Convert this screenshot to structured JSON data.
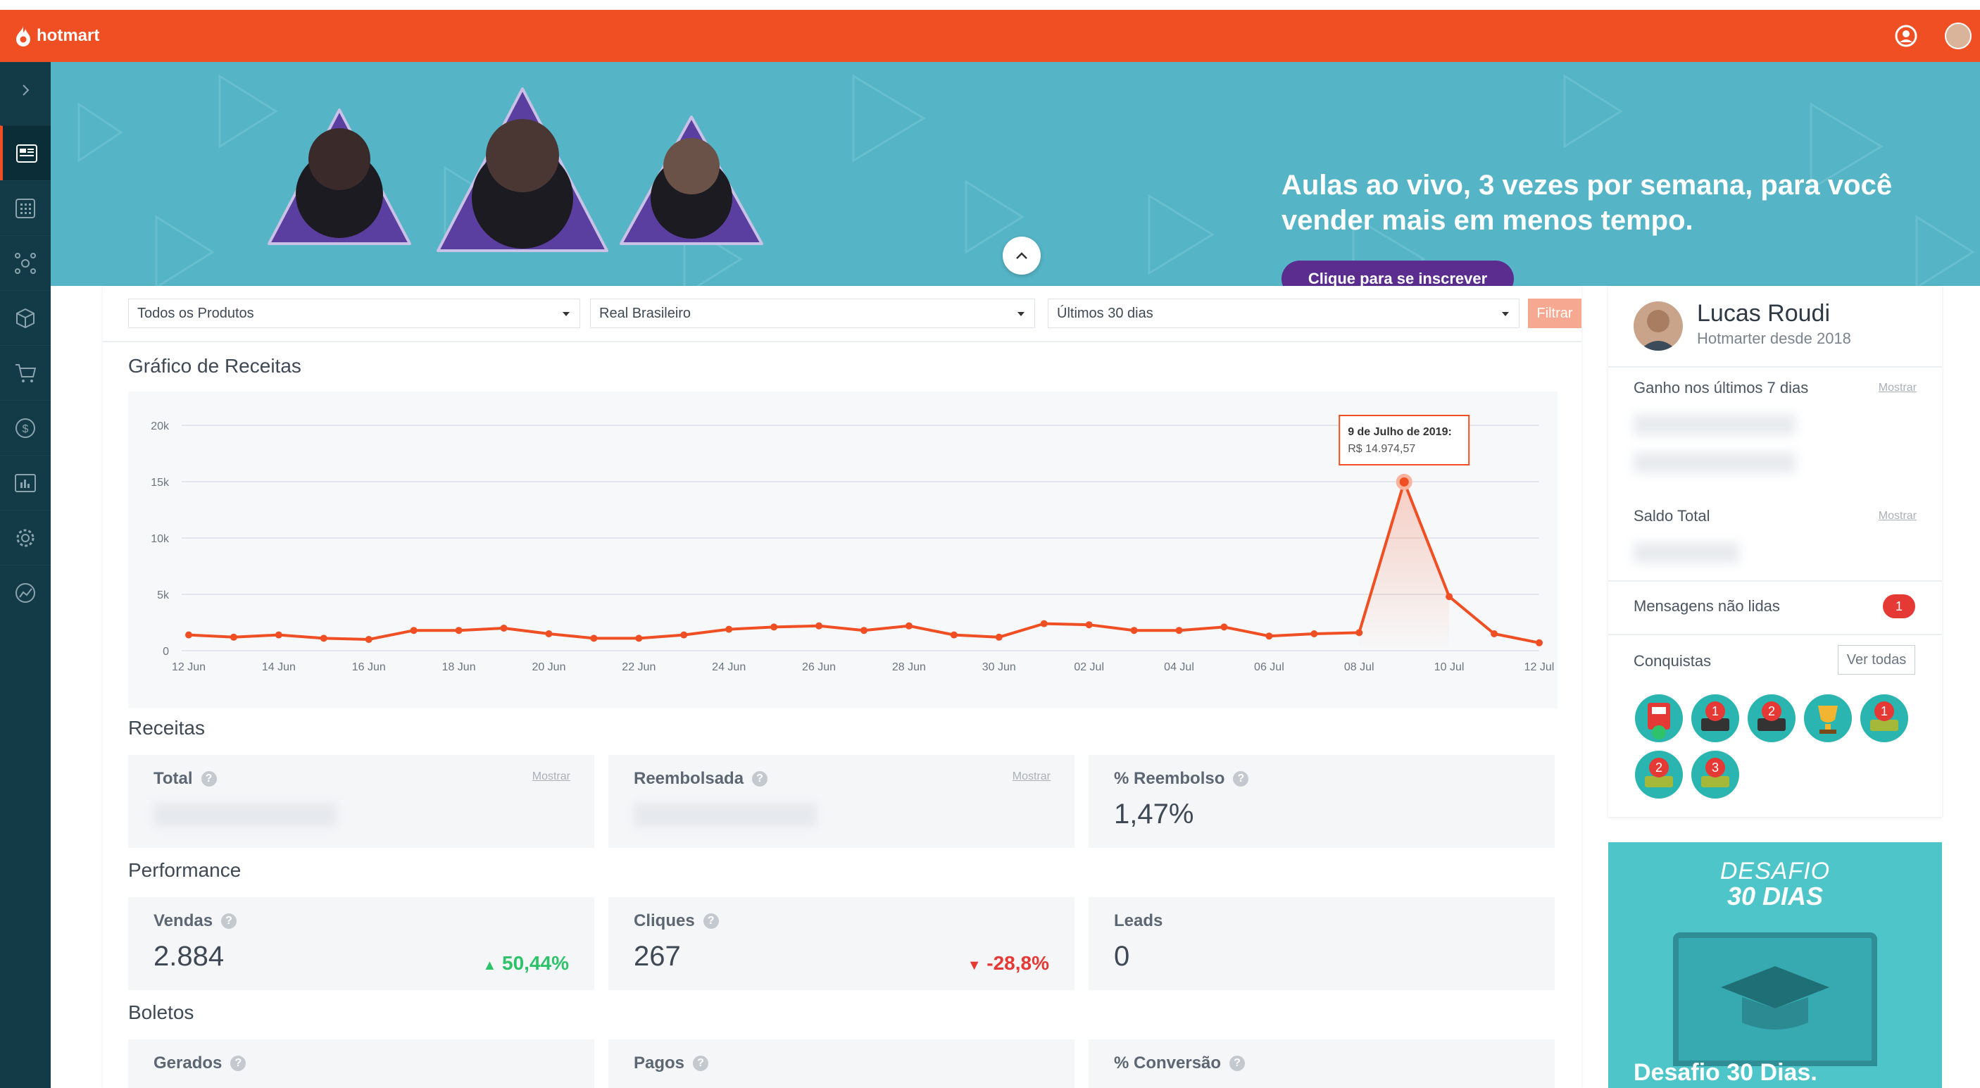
{
  "app": {
    "logo_text": "hotmart"
  },
  "banner": {
    "headline": "Aulas ao vivo, 3 vezes por semana, para você vender mais em menos tempo.",
    "cta": "Clique para se inscrever"
  },
  "filters": {
    "product": "Todos os Produtos",
    "currency": "Real Brasileiro",
    "period": "Últimos 30 dias",
    "button": "Filtrar"
  },
  "chart_section": {
    "title": "Gráfico de Receitas"
  },
  "chart_data": {
    "type": "line",
    "x": [
      "12 Jun",
      "13 Jun",
      "14 Jun",
      "15 Jun",
      "16 Jun",
      "17 Jun",
      "18 Jun",
      "19 Jun",
      "20 Jun",
      "21 Jun",
      "22 Jun",
      "23 Jun",
      "24 Jun",
      "25 Jun",
      "26 Jun",
      "27 Jun",
      "28 Jun",
      "29 Jun",
      "30 Jun",
      "01 Jul",
      "02 Jul",
      "03 Jul",
      "04 Jul",
      "05 Jul",
      "06 Jul",
      "07 Jul",
      "08 Jul",
      "09 Jul",
      "10 Jul",
      "11 Jul",
      "12 Jul"
    ],
    "xtick_labels": [
      "12 Jun",
      "14 Jun",
      "16 Jun",
      "18 Jun",
      "20 Jun",
      "22 Jun",
      "24 Jun",
      "26 Jun",
      "28 Jun",
      "30 Jun",
      "02 Jul",
      "04 Jul",
      "06 Jul",
      "08 Jul",
      "10 Jul",
      "12 Jul"
    ],
    "values": [
      1400,
      1200,
      1400,
      1100,
      1000,
      1800,
      1800,
      2000,
      1500,
      1100,
      1100,
      1400,
      1900,
      2100,
      2200,
      1800,
      2200,
      1400,
      1200,
      2400,
      2300,
      1800,
      1800,
      2100,
      1300,
      1500,
      1600,
      14974.57,
      4800,
      1500,
      700
    ],
    "ylim": [
      0,
      20000
    ],
    "yticks": [
      0,
      5000,
      10000,
      15000,
      20000
    ],
    "ytick_labels": [
      "0",
      "5k",
      "10k",
      "15k",
      "20k"
    ],
    "grid": true,
    "color": "#f04e23",
    "tooltip": {
      "title": "9 de Julho de 2019:",
      "value": "R$ 14.974,57",
      "index": 27
    }
  },
  "receitas": {
    "title": "Receitas",
    "total": {
      "label": "Total",
      "show": "Mostrar"
    },
    "reembolsada": {
      "label": "Reembolsada",
      "show": "Mostrar"
    },
    "pct": {
      "label": "% Reembolso",
      "value": "1,47%"
    }
  },
  "performance": {
    "title": "Performance",
    "vendas": {
      "label": "Vendas",
      "value": "2.884",
      "delta": "50,44%",
      "delta_color": "#2ec26a"
    },
    "cliques": {
      "label": "Cliques",
      "value": "267",
      "delta": "-28,8%",
      "delta_color": "#e53935"
    },
    "leads": {
      "label": "Leads",
      "value": "0"
    }
  },
  "boletos": {
    "title": "Boletos",
    "gerados": {
      "label": "Gerados"
    },
    "pagos": {
      "label": "Pagos"
    },
    "conversao": {
      "label": "% Conversão"
    }
  },
  "profile": {
    "name": "Lucas Roudi",
    "since": "Hotmarter desde 2018",
    "earned_label": "Ganho nos últimos 7 dias",
    "balance_label": "Saldo Total",
    "show": "Mostrar",
    "messages_label": "Mensagens não lidas",
    "messages_count": "1",
    "achievements_label": "Conquistas",
    "see_all": "Ver todas",
    "achievement_badges": [
      "1",
      "2",
      "1",
      "2",
      "3"
    ]
  },
  "promo": {
    "line1": "DESAFIO",
    "line2": "30 DIAS",
    "title": "Desafio 30 Dias."
  }
}
